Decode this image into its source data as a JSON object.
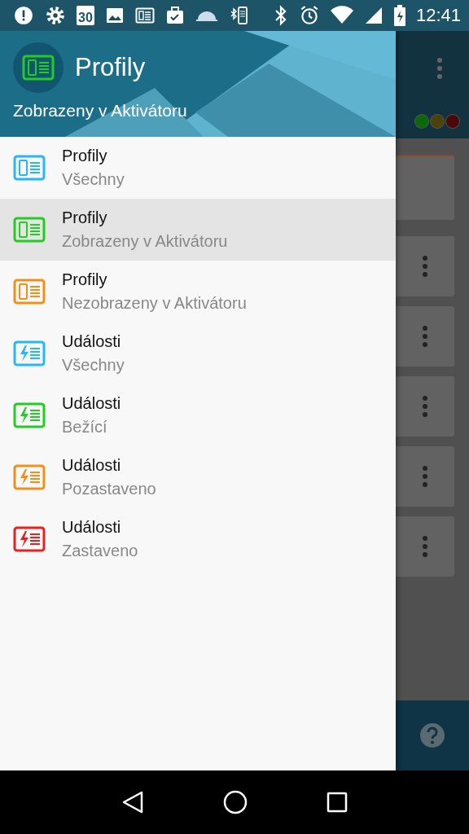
{
  "status_bar": {
    "calendar_day": "30",
    "time": "12:41"
  },
  "drawer": {
    "title": "Profily",
    "subtitle": "Zobrazeny v Aktivátoru",
    "items": [
      {
        "title": "Profily",
        "subtitle": "Všechny",
        "kind": "profile",
        "color": "#29b6f6",
        "selected": false
      },
      {
        "title": "Profily",
        "subtitle": "Zobrazeny v Aktivátoru",
        "kind": "profile",
        "color": "#22cc22",
        "selected": true
      },
      {
        "title": "Profily",
        "subtitle": "Nezobrazeny v Aktivátoru",
        "kind": "profile",
        "color": "#f0901a",
        "selected": false
      },
      {
        "title": "Události",
        "subtitle": "Všechny",
        "kind": "event",
        "color": "#29b6f6",
        "selected": false
      },
      {
        "title": "Události",
        "subtitle": "Bežící",
        "kind": "event",
        "color": "#22cc22",
        "selected": false
      },
      {
        "title": "Události",
        "subtitle": "Pozastaveno",
        "kind": "event",
        "color": "#f0901a",
        "selected": false
      },
      {
        "title": "Události",
        "subtitle": "Zastaveno",
        "kind": "event",
        "color": "#e52222",
        "selected": false
      }
    ]
  },
  "background": {
    "status_dots": [
      {
        "color": "#0a6a0a"
      },
      {
        "color": "#4a4208"
      },
      {
        "color": "#4a0808"
      }
    ]
  }
}
